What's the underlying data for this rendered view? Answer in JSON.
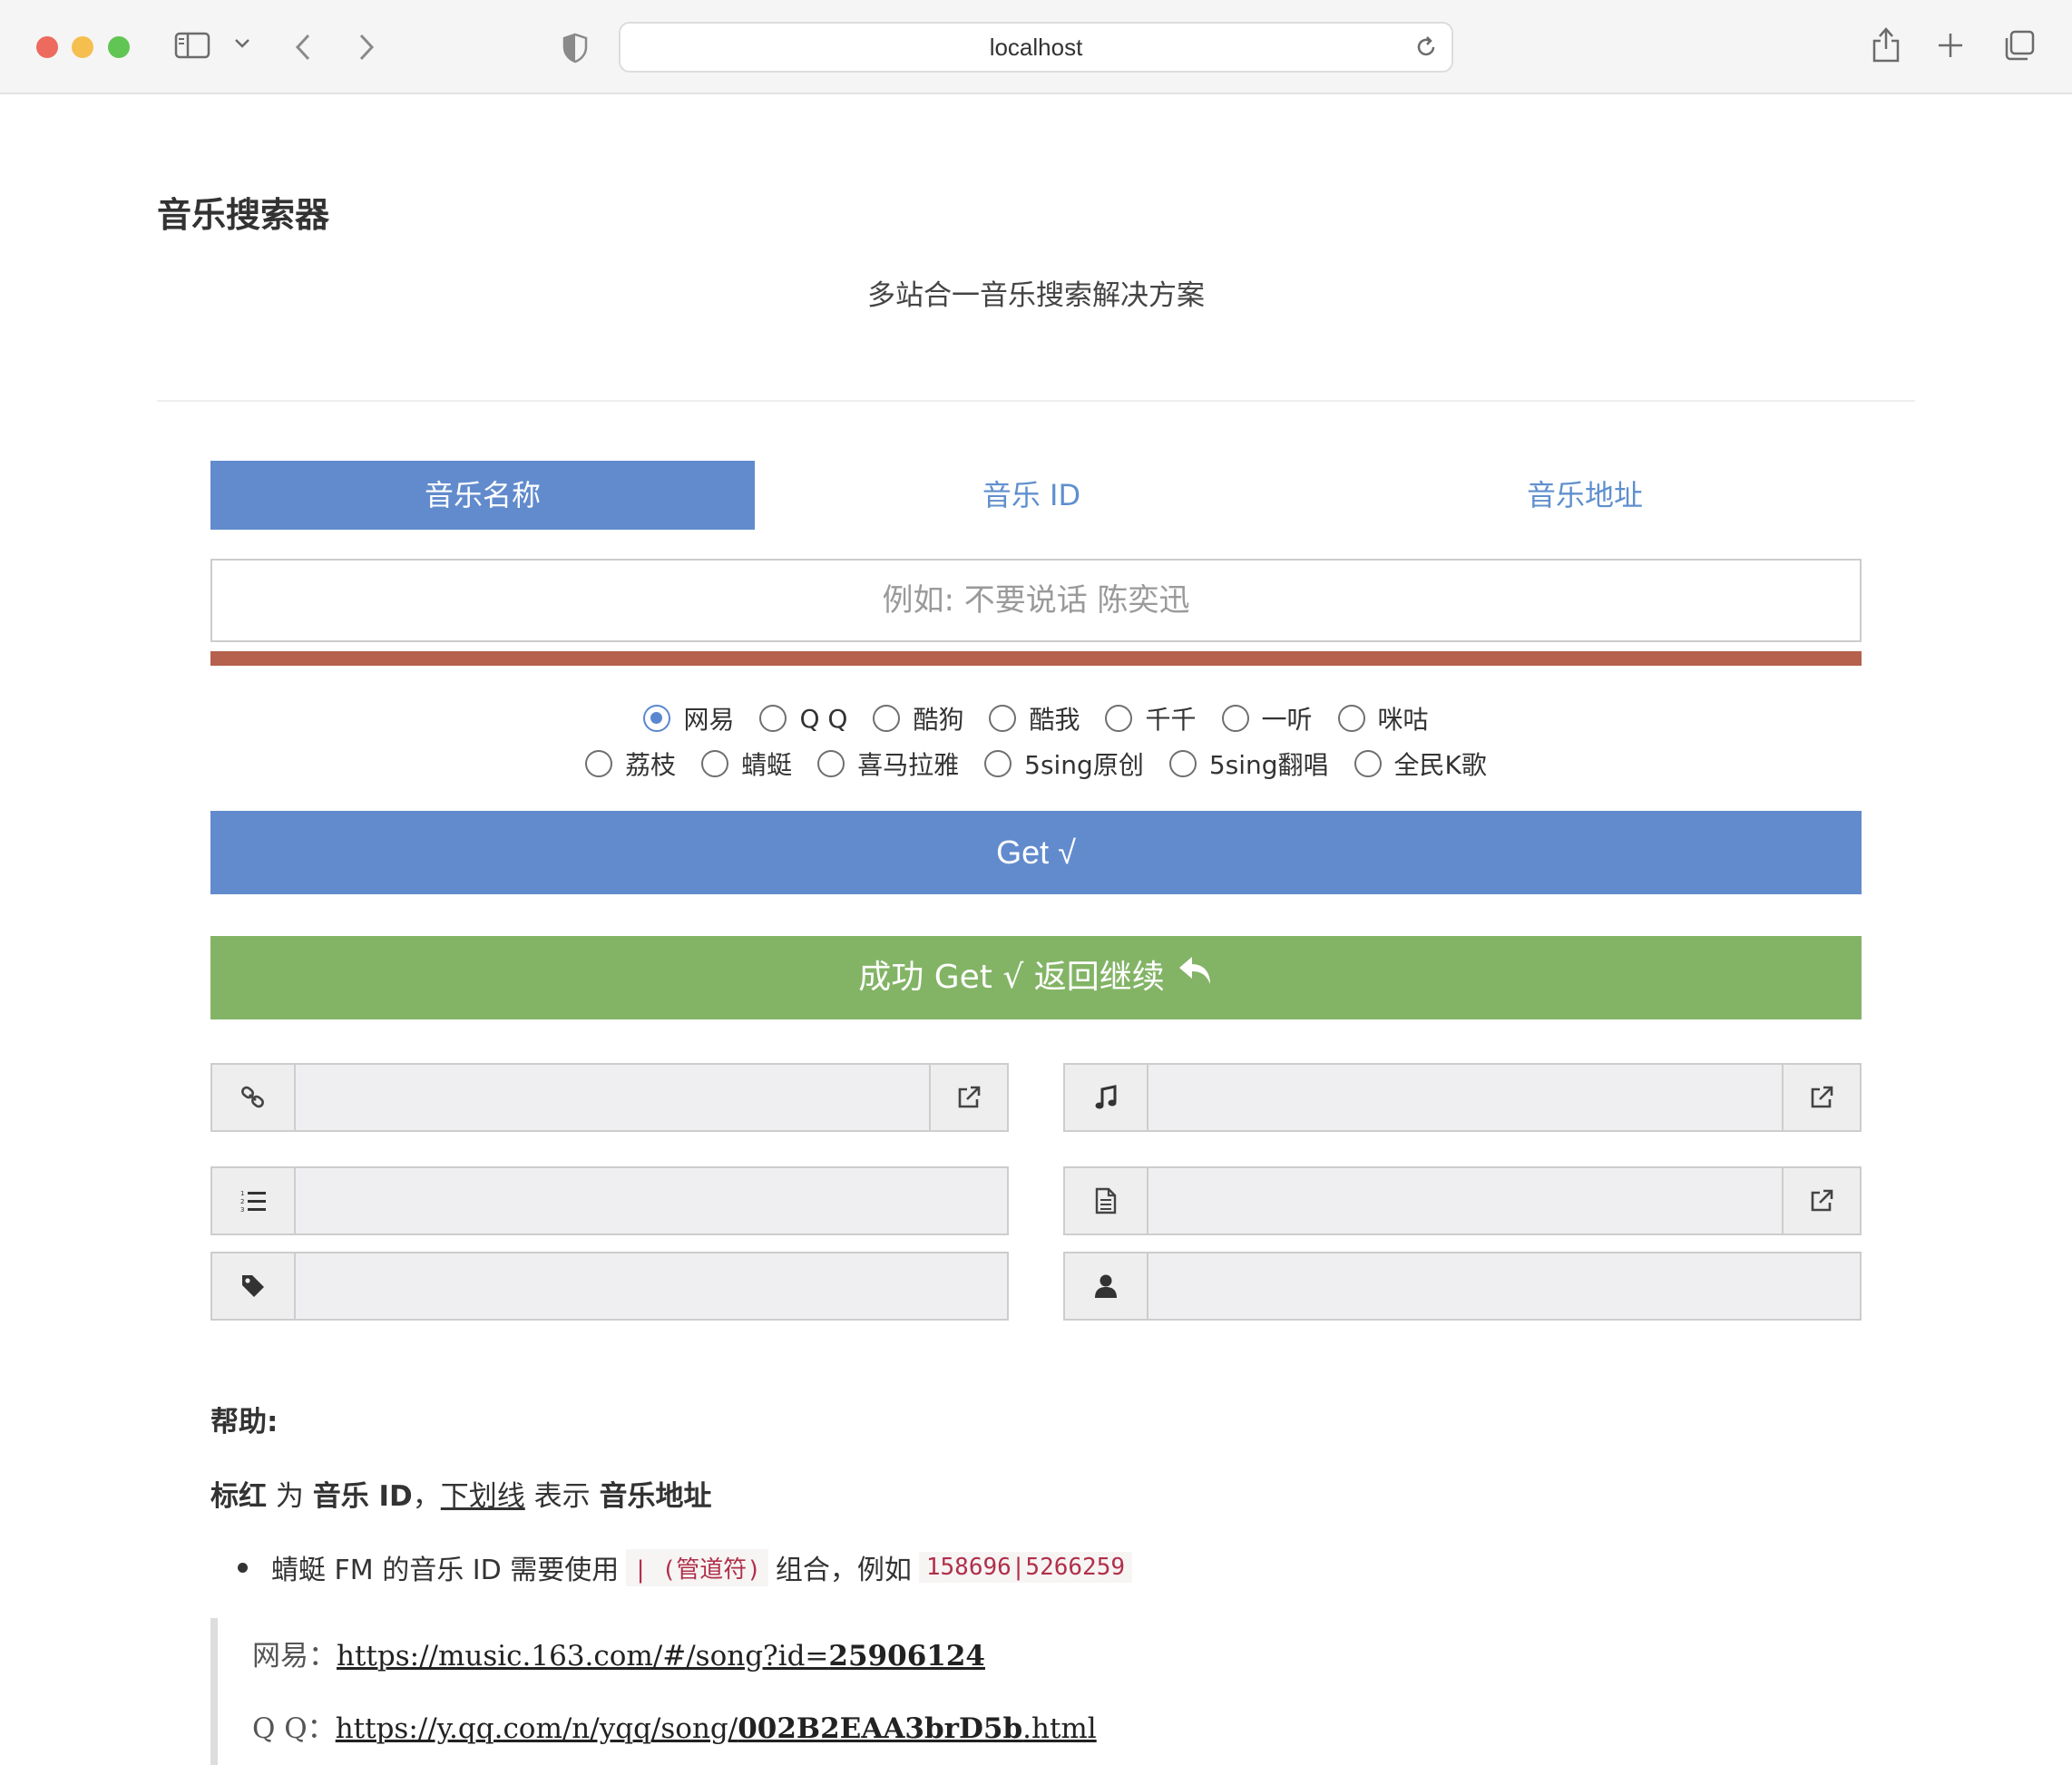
{
  "browser": {
    "url": "localhost"
  },
  "page": {
    "title": "音乐搜索器",
    "subtitle": "多站合一音乐搜索解决方案"
  },
  "tabs": [
    {
      "label": "音乐名称",
      "active": true
    },
    {
      "label": "音乐 ID",
      "active": false
    },
    {
      "label": "音乐地址",
      "active": false
    }
  ],
  "search": {
    "placeholder": "例如: 不要说话 陈奕迅",
    "value": ""
  },
  "sources_row1": [
    {
      "label": "网易",
      "checked": true
    },
    {
      "label": "Q Q",
      "checked": false
    },
    {
      "label": "酷狗",
      "checked": false
    },
    {
      "label": "酷我",
      "checked": false
    },
    {
      "label": "千千",
      "checked": false
    },
    {
      "label": "一听",
      "checked": false
    },
    {
      "label": "咪咕",
      "checked": false
    }
  ],
  "sources_row2": [
    {
      "label": "荔枝",
      "checked": false
    },
    {
      "label": "蜻蜓",
      "checked": false
    },
    {
      "label": "喜马拉雅",
      "checked": false
    },
    {
      "label": "5sing原创",
      "checked": false
    },
    {
      "label": "5sing翻唱",
      "checked": false
    },
    {
      "label": "全民K歌",
      "checked": false
    }
  ],
  "buttons": {
    "get": "Get √",
    "success": "成功 Get √ 返回继续"
  },
  "result_fields": {
    "link": "",
    "music_url": "",
    "lyrics_list": "",
    "lyrics_file": "",
    "song_title": "",
    "artist": ""
  },
  "help": {
    "title": "帮助:",
    "line_part1": "标红",
    "line_part2": " 为 ",
    "line_part3": "音乐 ID",
    "line_part4": "，",
    "line_part5": "下划线",
    "line_part6": " 表示 ",
    "line_part7": "音乐地址",
    "bullet_text1": "蜻蜓 FM 的音乐 ID 需要使用",
    "bullet_code1": "| (管道符)",
    "bullet_text2": "组合，例如",
    "bullet_code2": "158696|5266259",
    "examples": [
      {
        "label": "网易：",
        "url_prefix": "https://music.163.com/#/song?id=",
        "url_id": "25906124",
        "url_suffix": ""
      },
      {
        "label": "Q Q：",
        "url_prefix": "https://y.qq.com/n/yqq/song/",
        "url_id": "002B2EAA3brD5b",
        "url_suffix": ".html"
      }
    ]
  },
  "colors": {
    "primary": "#628bcd",
    "success": "#83b466",
    "error_bar": "#b5614d"
  }
}
